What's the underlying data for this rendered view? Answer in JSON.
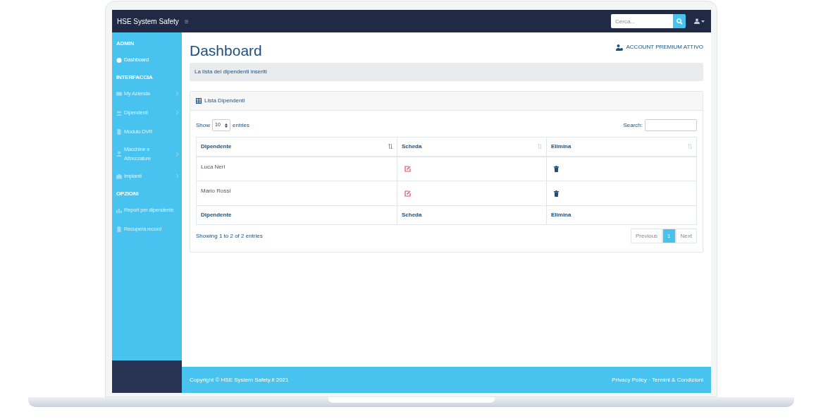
{
  "navbar": {
    "brand": "HSE System Safety",
    "menu_toggle": "≡",
    "search": {
      "placeholder": "Cerca..."
    }
  },
  "sidebar": {
    "sections": [
      {
        "heading": "ADMIN",
        "items": [
          {
            "label": "Dashboard",
            "selected": true,
            "submenu": false
          }
        ]
      },
      {
        "heading": "INTERFACCIA",
        "items": [
          {
            "label": "My Azienda",
            "selected": false,
            "submenu": true
          },
          {
            "label": "Dipendenti",
            "selected": false,
            "submenu": true
          },
          {
            "label": "Modulo DVR",
            "selected": false,
            "submenu": false
          },
          {
            "label": "Macchine e Attrezzature",
            "selected": false,
            "submenu": true
          },
          {
            "label": "Impianti",
            "selected": false,
            "submenu": true
          }
        ]
      },
      {
        "heading": "OPZIONI",
        "items": [
          {
            "label": "Report per dipendente",
            "selected": false,
            "submenu": false
          },
          {
            "label": "Recupera record",
            "selected": false,
            "submenu": false
          }
        ]
      }
    ]
  },
  "page": {
    "title": "Dashboard",
    "account_badge": "ACCOUNT PREMIUM ATTIVO",
    "breadcrumb": "La lista dei dipendenti inseriti"
  },
  "card": {
    "title": "Lista Dipendenti",
    "length_label_before": "Show",
    "length_value": "10",
    "length_label_after": "entries",
    "search_label": "Search:",
    "columns": [
      {
        "label": "Dipendente",
        "sorted": true
      },
      {
        "label": "Scheda",
        "sorted": false
      },
      {
        "label": "Elimina",
        "sorted": false
      }
    ],
    "rows": [
      {
        "name": "Luca Neri"
      },
      {
        "name": "Mario Rossi"
      }
    ],
    "footer_columns": [
      "Dipendente",
      "Scheda",
      "Elimina"
    ],
    "info": "Showing 1 to 2 of 2 entries",
    "pagination": [
      {
        "label": "Previous",
        "selected": false
      },
      {
        "label": "1",
        "selected": true
      },
      {
        "label": "Next",
        "selected": false
      }
    ]
  },
  "footer": {
    "copyright": "Copyright © HSE System Safety.it 2021",
    "links": "Privacy Policy · Termini & Condizioni"
  }
}
